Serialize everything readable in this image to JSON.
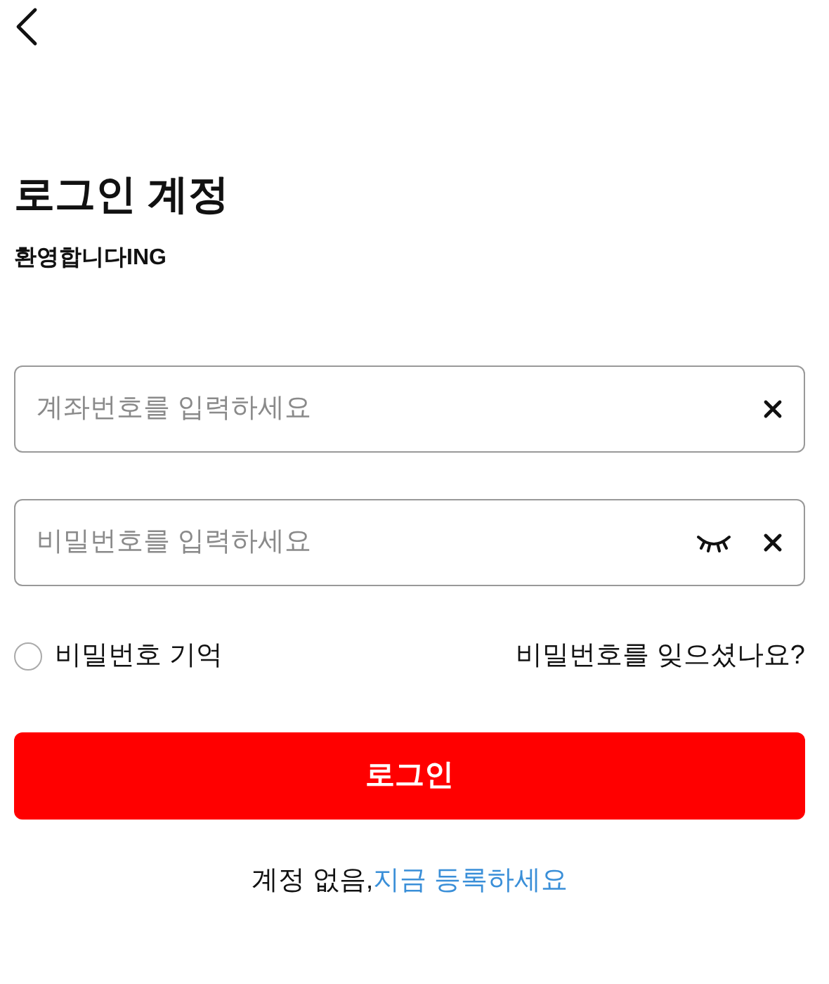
{
  "title": "로그인 계정",
  "subtitle": "환영합니다ING",
  "fields": [
    {
      "kind": "text",
      "placeholder": "계좌번호를 입력하세요"
    },
    {
      "kind": "password",
      "placeholder": "비밀번호를 입력하세요"
    }
  ],
  "remember": {
    "label": "비밀번호 기억",
    "checked": false
  },
  "forgot_link": "비밀번호를 잊으셨나요?",
  "login_button": "로그인",
  "footer": {
    "text": "계정 없음,",
    "link": "지금 등록하세요"
  }
}
